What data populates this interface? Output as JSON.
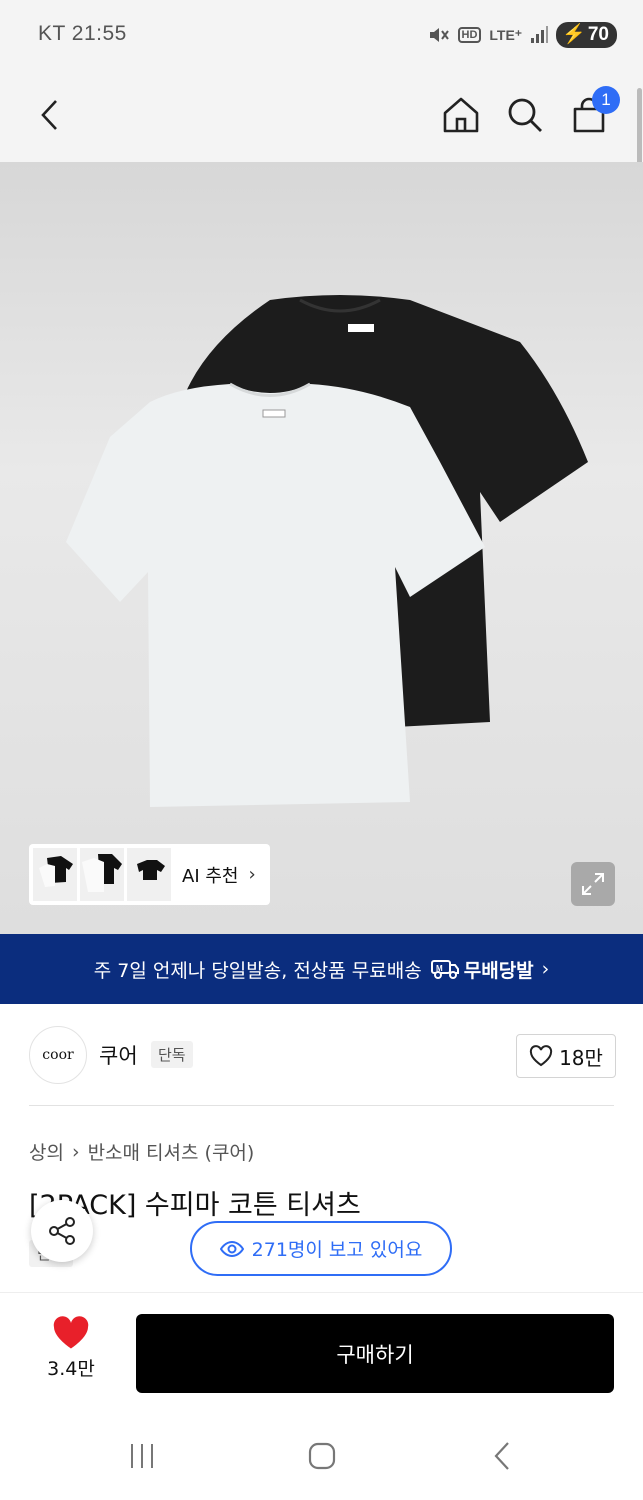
{
  "status_bar": {
    "carrier_time": "KT 21:55",
    "network": "LTE⁺",
    "battery": "70"
  },
  "header": {
    "cart_count": "1"
  },
  "gallery": {
    "ai_label": "AI 추천",
    "ai_chevron": "›"
  },
  "banner": {
    "text": "주 7일 언제나 당일발송, 전상품 무료배송",
    "service": "무배당발",
    "chevron": "›"
  },
  "brand": {
    "logo_text": "coor",
    "name": "쿠어",
    "tag": "단독",
    "likes": "18만"
  },
  "breadcrumb": {
    "category": "상의",
    "separator": "›",
    "subcategory": "반소매 티셔츠 (쿠어)"
  },
  "product": {
    "title": "[2PACK] 수피마 코튼 티셔츠",
    "tag": "단독"
  },
  "viewers": {
    "text": "271명이 보고 있어요"
  },
  "bottom": {
    "like_count": "3.4만",
    "buy_label": "구매하기"
  },
  "colors": {
    "accent_blue": "#2f6df6",
    "banner_navy": "#0b2d7e",
    "heart_red": "#e8202a"
  }
}
